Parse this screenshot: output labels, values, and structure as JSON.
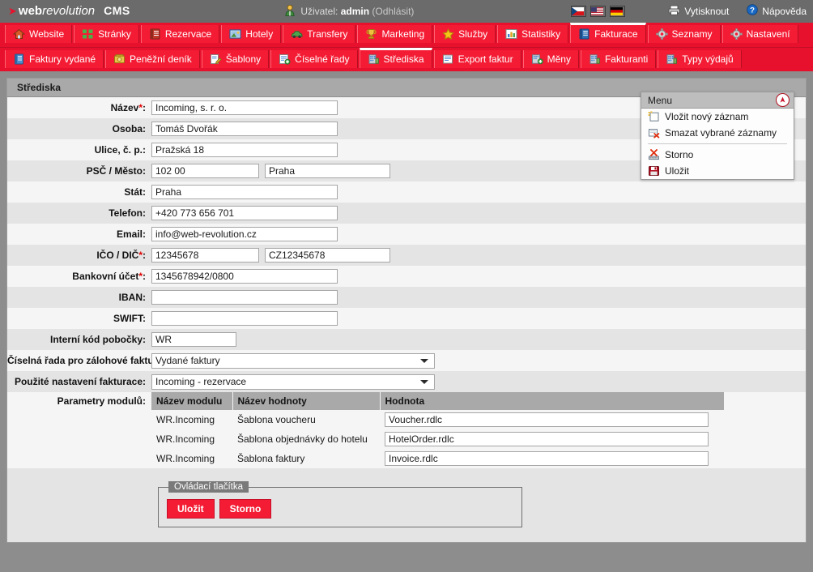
{
  "header": {
    "brand_web": "web",
    "brand_revolution": "revolution",
    "brand_cms": "CMS",
    "user_prefix": "Uživatel:",
    "user_name": "admin",
    "logout": "(Odhlásit)",
    "print_label": "Vytisknout",
    "help_label": "Nápověda",
    "flags": [
      {
        "name": "flag-cz",
        "title": "Čeština"
      },
      {
        "name": "flag-us",
        "title": "English"
      },
      {
        "name": "flag-de",
        "title": "Deutsch"
      }
    ],
    "accent_color": "#e8112d",
    "topbar_color": "#6b6b6b"
  },
  "nav_primary": [
    {
      "label": "Website",
      "icon": "house-icon",
      "active": false
    },
    {
      "label": "Stránky",
      "icon": "pages-icon",
      "active": false
    },
    {
      "label": "Rezervace",
      "icon": "book-icon",
      "active": false
    },
    {
      "label": "Hotely",
      "icon": "hotel-icon",
      "active": false
    },
    {
      "label": "Transfery",
      "icon": "car-icon",
      "active": false
    },
    {
      "label": "Marketing",
      "icon": "trophy-icon",
      "active": false
    },
    {
      "label": "Služby",
      "icon": "star-icon",
      "active": false
    },
    {
      "label": "Statistiky",
      "icon": "chart-icon",
      "active": false
    },
    {
      "label": "Fakturace",
      "icon": "invoice-book-icon",
      "active": true
    },
    {
      "label": "Seznamy",
      "icon": "gear-icon",
      "active": false
    },
    {
      "label": "Nastavení",
      "icon": "gear-icon",
      "active": false
    }
  ],
  "nav_secondary": [
    {
      "label": "Faktury vydané",
      "icon": "book-blue-icon",
      "active": false
    },
    {
      "label": "Peněžní deník",
      "icon": "money-icon",
      "active": false
    },
    {
      "label": "Šablony",
      "icon": "edit-icon",
      "active": false
    },
    {
      "label": "Číselné řady",
      "icon": "list-add-icon",
      "active": false
    },
    {
      "label": "Střediska",
      "icon": "building-icon",
      "active": true
    },
    {
      "label": "Export faktur",
      "icon": "export-icon",
      "active": false
    },
    {
      "label": "Měny",
      "icon": "currency-icon",
      "active": false
    },
    {
      "label": "Fakturanti",
      "icon": "building-icon",
      "active": false
    },
    {
      "label": "Typy výdajů",
      "icon": "building-icon",
      "active": false
    }
  ],
  "panel": {
    "title": "Střediska"
  },
  "form": {
    "fields": [
      {
        "label": "Název",
        "required": true,
        "value": "Incoming, s. r. o.",
        "name": "nazev"
      },
      {
        "label": "Osoba",
        "required": false,
        "value": "Tomáš Dvořák",
        "name": "osoba"
      },
      {
        "label": "Ulice, č. p.",
        "required": false,
        "value": "Pražská 18",
        "name": "ulice"
      },
      {
        "label": "PSČ / Město",
        "required": false,
        "value": "102 00",
        "value2": "Praha",
        "name": "psc-mesto"
      },
      {
        "label": "Stát",
        "required": false,
        "value": "Praha",
        "name": "stat"
      },
      {
        "label": "Telefon",
        "required": false,
        "value": "+420 773 656 701",
        "name": "telefon"
      },
      {
        "label": "Email",
        "required": false,
        "value": "info@web-revolution.cz",
        "name": "email"
      },
      {
        "label": "IČO / DIČ",
        "required": true,
        "value": "12345678",
        "value2": "CZ12345678",
        "name": "ico-dic"
      },
      {
        "label": "Bankovní účet",
        "required": true,
        "value": "1345678942/0800",
        "name": "bankovni-ucet"
      },
      {
        "label": "IBAN",
        "required": false,
        "value": "",
        "name": "iban"
      },
      {
        "label": "SWIFT",
        "required": false,
        "value": "",
        "name": "swift"
      },
      {
        "label": "Interní kód pobočky",
        "required": false,
        "value": "WR",
        "name": "interni-kod"
      }
    ],
    "selects": [
      {
        "label": "Číselná řada pro zálohové faktury",
        "value": "Vydané faktury",
        "name": "ciselna-rada"
      },
      {
        "label": "Použité nastavení fakturace",
        "value": "Incoming - rezervace",
        "name": "nastaveni-fakturace"
      }
    ],
    "params_label": "Parametry modulů",
    "params_table": {
      "headers": [
        "Název modulu",
        "Název hodnoty",
        "Hodnota"
      ],
      "rows": [
        {
          "module": "WR.Incoming",
          "name": "Šablona voucheru",
          "value": "Voucher.rdlc"
        },
        {
          "module": "WR.Incoming",
          "name": "Šablona objednávky do hotelu",
          "value": "HotelOrder.rdlc"
        },
        {
          "module": "WR.Incoming",
          "name": "Šablona faktury",
          "value": "Invoice.rdlc"
        }
      ]
    }
  },
  "controls": {
    "legend": "Ovládací tlačítka",
    "save": "Uložit",
    "cancel": "Storno"
  },
  "menu": {
    "title": "Menu",
    "items": [
      {
        "label": "Vložit nový záznam",
        "icon": "new-record-icon"
      },
      {
        "label": "Smazat vybrané záznamy",
        "icon": "delete-record-icon"
      },
      {
        "label": "Storno",
        "icon": "cancel-icon",
        "after_separator": true
      },
      {
        "label": "Uložit",
        "icon": "save-disk-icon"
      }
    ]
  }
}
